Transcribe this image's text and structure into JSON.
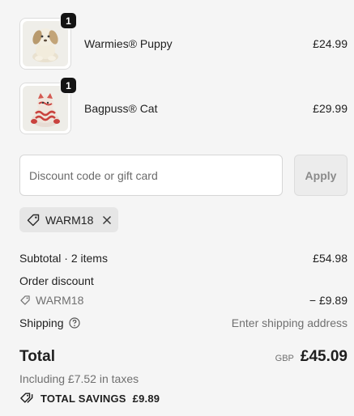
{
  "line_items": [
    {
      "name": "Warmies® Puppy",
      "price": "£24.99",
      "quantity": "1",
      "image": "plush-puppy-image"
    },
    {
      "name": "Bagpuss® Cat",
      "price": "£29.99",
      "quantity": "1",
      "image": "plush-cat-image"
    }
  ],
  "discount": {
    "placeholder": "Discount code or gift card",
    "value": "",
    "apply_label": "Apply",
    "applied_code": "WARM18"
  },
  "summary": {
    "subtotal_label": "Subtotal · 2 items",
    "subtotal_value": "£54.98",
    "order_discount_label": "Order discount",
    "discount_code": "WARM18",
    "discount_value": "− £9.89",
    "shipping_label": "Shipping",
    "shipping_value": "Enter shipping address",
    "total_label": "Total",
    "currency": "GBP",
    "total_value": "£45.09",
    "tax_note": "Including £7.52 in taxes",
    "savings_label": "TOTAL SAVINGS",
    "savings_value": "£9.89"
  },
  "colors": {
    "background": "#f5f5f5",
    "badge": "#141414",
    "chip": "#e6e6e6",
    "muted_text": "#707070"
  }
}
